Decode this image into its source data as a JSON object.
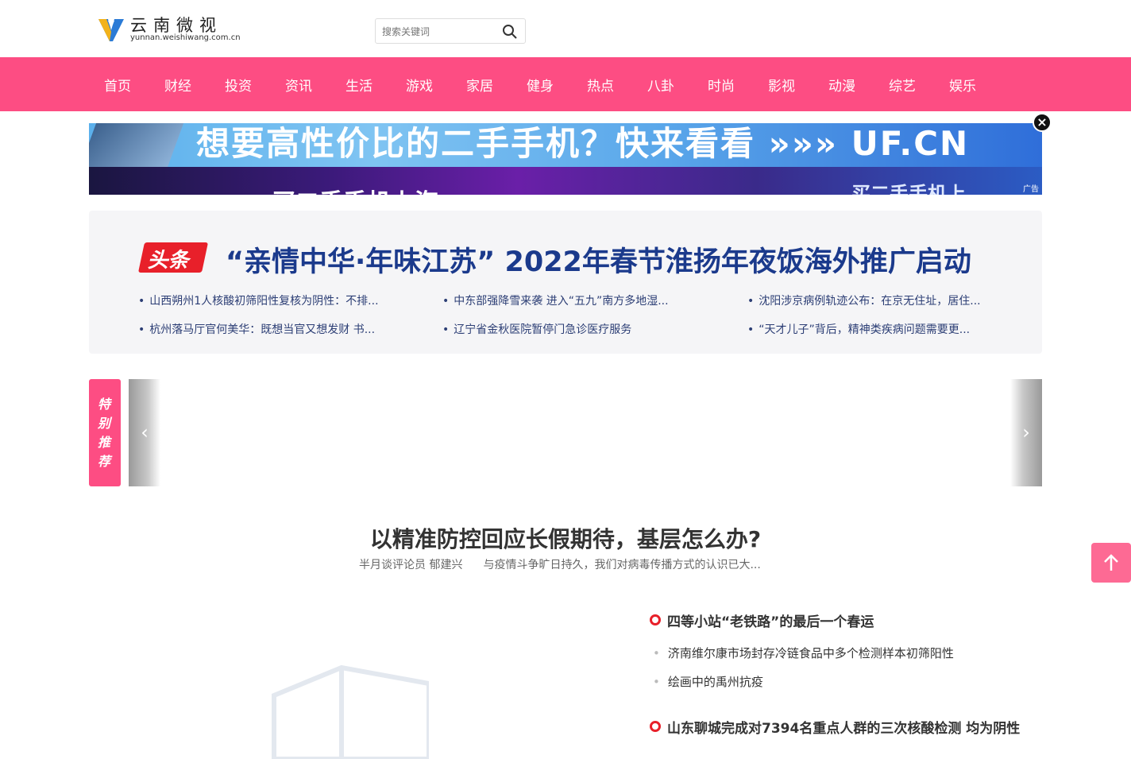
{
  "brand": {
    "logo_text": "云南微视",
    "logo_url": "yunnan.weishiwang.com.cn",
    "accent": "#fd4d83",
    "headline_color": "#1b3a8c",
    "badge_red": "#e8202a"
  },
  "search": {
    "placeholder": "搜索关键词",
    "icon": "search-icon"
  },
  "nav": {
    "items": [
      "首页",
      "财经",
      "投资",
      "资讯",
      "生活",
      "游戏",
      "家居",
      "健身",
      "热点",
      "八卦",
      "时尚",
      "影视",
      "动漫",
      "综艺",
      "娱乐"
    ]
  },
  "ad": {
    "slogan": "想要高性价比的二手手机？快来看看 »»» UF.CN",
    "strip": "买二手手机上海",
    "strip2": "买二手手机上",
    "tag": "广告",
    "close": "close-icon"
  },
  "headline": {
    "badge": "头条",
    "title": "“亲情中华·年味江苏” 2022年春节淮扬年夜饭海外推广启动",
    "links": [
      "山西朔州1人核酸初筛阳性复核为阴性：不排...",
      "中东部强降雪来袭 进入“五九”南方多地湿...",
      "沈阳涉京病例轨迹公布：在京无住址，居住...",
      "杭州落马厅官何美华：既想当官又想发财 书...",
      "辽宁省金秋医院暂停门急诊医疗服务",
      "“天才儿子”背后，精神类疾病问题需要更..."
    ]
  },
  "special": {
    "tag": "特别推荐",
    "prev": "‹",
    "next": "›"
  },
  "feature": {
    "title": "以精准防控回应长假期待，基层怎么办?",
    "author": "半月谈评论员 郁建兴",
    "summary": "与疫情斗争旷日持久，我们对病毒传播方式的认识已大..."
  },
  "side": {
    "head1": "四等小站“老铁路”的最后一个春运",
    "links": [
      "济南维尔康市场封存冷链食品中多个检测样本初筛阳性",
      "绘画中的禹州抗疫"
    ],
    "head2": "山东聊城完成对7394名重点人群的三次核酸检测 均为阴性"
  },
  "to_top": {
    "icon": "arrow-up-icon"
  }
}
